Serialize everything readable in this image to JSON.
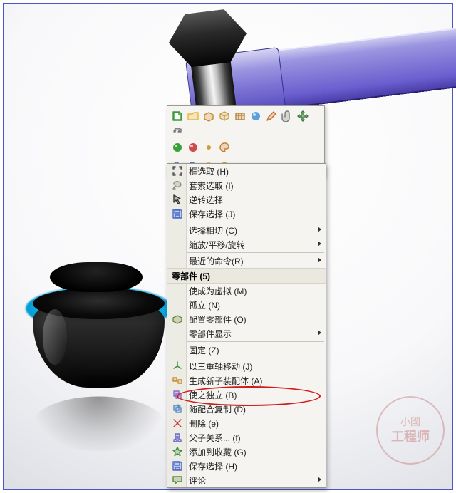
{
  "toolbar": {
    "icons_row1": [
      "new-doc",
      "open-folder",
      "assembly",
      "model-cube",
      "part-crate",
      "material-ball",
      "sketch-pencil",
      "paperclip",
      "move-tool",
      "rebuild"
    ],
    "icons_row2": [
      "appearance-ball",
      "rgb-ball",
      "dot",
      "palette"
    ],
    "icons_row3": [
      "zoom-out",
      "zoom-in",
      "iso1",
      "iso2"
    ]
  },
  "menu": {
    "section1": [
      {
        "icon": "box-select",
        "label": "框选取 (H)"
      },
      {
        "icon": "lasso",
        "label": "套索选取 (I)"
      },
      {
        "icon": "cursor-invert",
        "label": "逆转选择"
      },
      {
        "icon": "save",
        "label": "保存选择 (J)"
      }
    ],
    "section2": [
      {
        "label": "选择相切 (C)",
        "submenu": true
      },
      {
        "label": "缩放/平移/旋转",
        "submenu": true
      }
    ],
    "section3": [
      {
        "label": "最近的命令(R)",
        "submenu": true
      }
    ],
    "header": "零部件 (5)",
    "section4": [
      {
        "icon": "",
        "label": "使成为虚拟 (M)"
      },
      {
        "icon": "",
        "label": "孤立 (N)"
      },
      {
        "icon": "config",
        "label": "配置零部件 (O)"
      },
      {
        "icon": "",
        "label": "零部件显示",
        "submenu": true
      },
      {
        "icon": "",
        "label": "固定 (Z)",
        "highlighted": true
      },
      {
        "icon": "triad",
        "label": "以三重轴移动 (J)"
      },
      {
        "icon": "subassy",
        "label": "生成新子装配体 (A)"
      },
      {
        "icon": "independent",
        "label": "使之独立 (B)"
      },
      {
        "icon": "copy-mate",
        "label": "随配合复制 (D)"
      },
      {
        "icon": "delete",
        "label": "删除 (e)"
      },
      {
        "icon": "parent",
        "label": "父子关系... (f)"
      },
      {
        "icon": "favorite",
        "label": "添加到收藏 (G)"
      },
      {
        "icon": "save",
        "label": "保存选择 (H)"
      },
      {
        "icon": "comment",
        "label": "评论",
        "submenu": true
      }
    ]
  },
  "watermark": {
    "line1": "小國",
    "line2": "工程师"
  }
}
